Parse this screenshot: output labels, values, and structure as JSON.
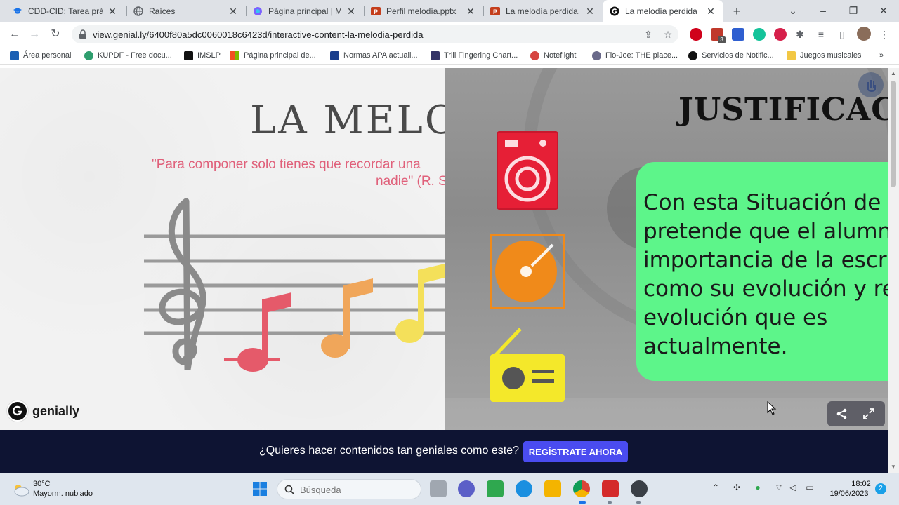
{
  "browser": {
    "tabs": [
      {
        "title": "CDD-CID: Tarea práctica",
        "icon": "graduation-cap-icon",
        "color": "#1a73e8"
      },
      {
        "title": "Raíces",
        "icon": "globe-icon",
        "color": "#5f6368"
      },
      {
        "title": "Página principal | Microsoft",
        "icon": "copilot-icon",
        "color": "#7b61ff"
      },
      {
        "title": "Perfil melodía.pptx",
        "icon": "powerpoint-icon",
        "color": "#c43e1c"
      },
      {
        "title": "La melodía perdida.pptx",
        "icon": "powerpoint-icon",
        "color": "#c43e1c"
      },
      {
        "title": "La melodía perdida",
        "icon": "genially-icon",
        "color": "#111111"
      }
    ],
    "active_tab": 5,
    "url": "view.genial.ly/6400f80a5dc0060018c6423d/interactive-content-la-melodia-perdida",
    "extension_badge": "3",
    "bookmarks": [
      {
        "label": "Área personal",
        "color": "#1a5fb4"
      },
      {
        "label": "KUPDF - Free docu...",
        "color": "#2f9e6e"
      },
      {
        "label": "IMSLP",
        "color": "#111111"
      },
      {
        "label": "Página principal de...",
        "color": "#f25022"
      },
      {
        "label": "Normas APA actuali...",
        "color": "#1a3e8c"
      },
      {
        "label": "Trill Fingering Chart...",
        "color": "#333366"
      },
      {
        "label": "Noteflight",
        "color": "#d64541"
      },
      {
        "label": "Flo-Joe: THE place...",
        "color": "#6a6a8a"
      },
      {
        "label": "Servicios de Notific...",
        "color": "#111111"
      },
      {
        "label": "Juegos musicales",
        "color": "#f2c744"
      }
    ]
  },
  "slide_left": {
    "title": "LA MELODÍ",
    "quote_line1": "\"Para componer solo tienes que recordar una",
    "quote_line2": "nadie\" (R. S",
    "brand": "genially"
  },
  "slide_right": {
    "title": "JUSTIFICACI",
    "text_lines": [
      "Con  esta  Situación  de",
      "pretende  que  el  alumn",
      "importancia  de  la  escr",
      "como su evolución y re",
      "evolución        que        es",
      "actualmente."
    ],
    "icons": [
      "speaker-icon",
      "turntable-icon",
      "radio-icon"
    ]
  },
  "banner": {
    "question": "¿Quieres hacer contenidos tan geniales como este?",
    "cta": "REGÍSTRATE AHORA"
  },
  "taskbar": {
    "temperature": "30°C",
    "weather": "Mayorm. nublado",
    "search_placeholder": "Búsqueda",
    "time": "18:02",
    "date": "19/06/2023",
    "notifications": "2"
  },
  "colors": {
    "green_panel": "#5df58a",
    "banner_bg": "#0e1433",
    "cta": "#4a4cf0",
    "quote": "#e0607a"
  }
}
